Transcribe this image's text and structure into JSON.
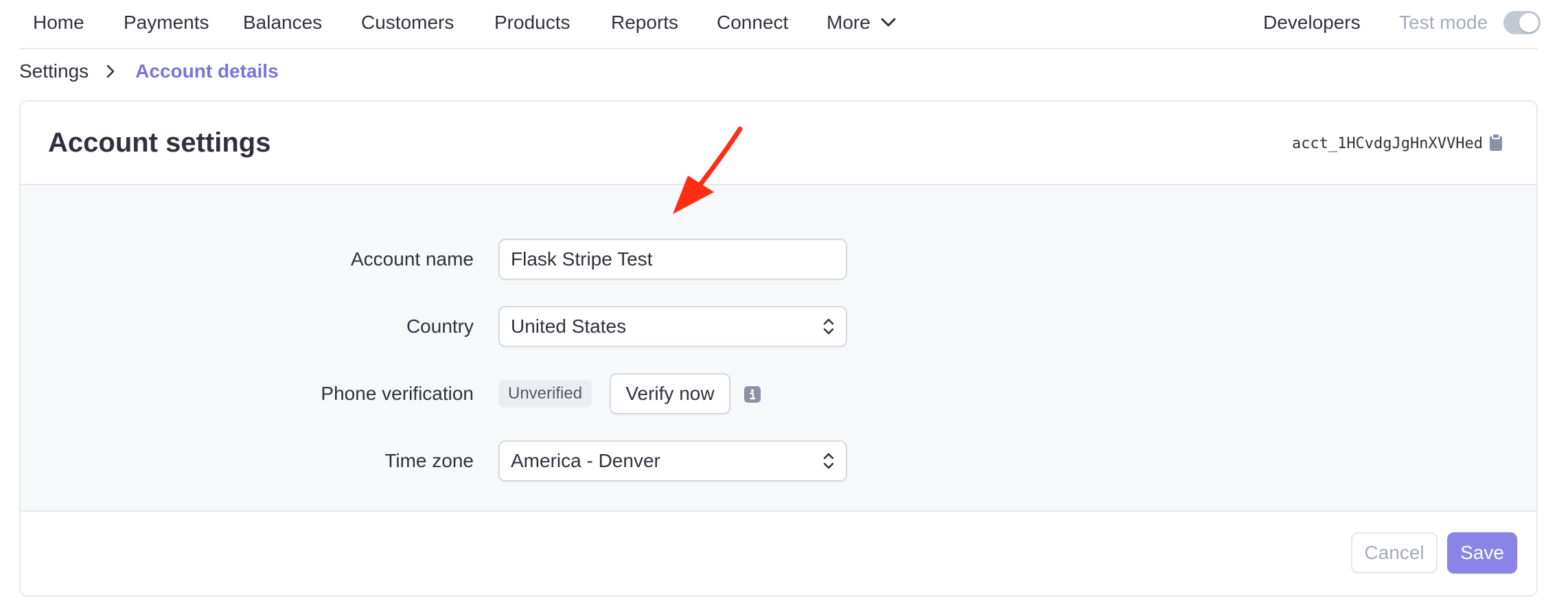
{
  "nav": {
    "items": [
      "Home",
      "Payments",
      "Balances",
      "Customers",
      "Products",
      "Reports",
      "Connect"
    ],
    "more_label": "More",
    "developers_label": "Developers",
    "test_mode_label": "Test mode",
    "test_mode_on": false
  },
  "breadcrumb": {
    "root": "Settings",
    "current": "Account details"
  },
  "card": {
    "title": "Account settings",
    "account_id": "acct_1HCvdgJgHnXVVHed"
  },
  "form": {
    "account_name": {
      "label": "Account name",
      "value": "Flask Stripe Test"
    },
    "country": {
      "label": "Country",
      "value": "United States"
    },
    "phone_verification": {
      "label": "Phone verification",
      "status": "Unverified",
      "action": "Verify now"
    },
    "time_zone": {
      "label": "Time zone",
      "value": "America - Denver"
    }
  },
  "footer": {
    "cancel_label": "Cancel",
    "save_label": "Save"
  },
  "icons": {
    "more": "chevron-down-icon",
    "breadcrumb_separator": "chevron-right-icon",
    "copy": "clipboard-icon",
    "select": "chevron-up-down-icon",
    "info": "info-icon",
    "annotation": "arrow-icon"
  },
  "colors": {
    "accent": "#7a73e0",
    "save_button": "#8b84e6",
    "annotation_arrow": "#ff2d14",
    "body_background": "#f6f8fa"
  }
}
